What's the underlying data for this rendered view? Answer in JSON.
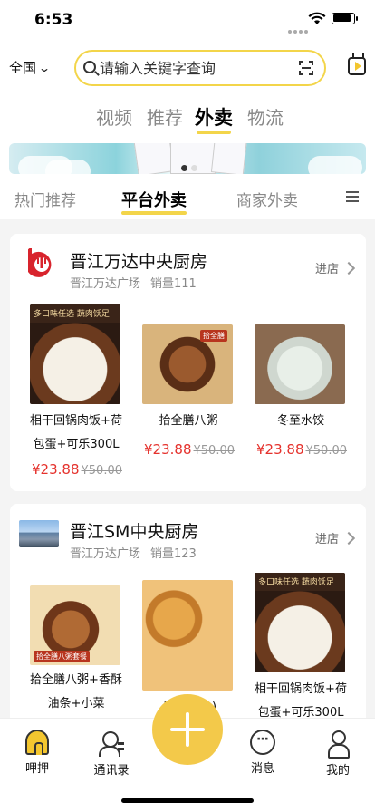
{
  "status_bar": {
    "time": "6:53"
  },
  "header": {
    "region": "全国",
    "search_placeholder": "请输入关键字查询"
  },
  "category_tabs": [
    {
      "label": "视频",
      "active": false
    },
    {
      "label": "推荐",
      "active": false
    },
    {
      "label": "外卖",
      "active": true
    },
    {
      "label": "物流",
      "active": false
    }
  ],
  "sub_tabs": [
    {
      "label": "热门推荐",
      "active": false
    },
    {
      "label": "平台外卖",
      "active": true
    },
    {
      "label": "商家外卖",
      "active": false
    }
  ],
  "shops": [
    {
      "name": "晋江万达中央厨房",
      "address": "晋江万达广场",
      "sales": "销量111",
      "enter_label": "进店",
      "products": [
        {
          "name_line1": "相干回锅肉饭+荷",
          "name_line2": "包蛋+可乐300L",
          "price": "¥23.88",
          "original_price": "¥50.00",
          "image": "rice-bowl",
          "image_caption": "多口味任选 蔬肉饫足"
        },
        {
          "name_line1": "拾全膳八粥",
          "name_line2": "",
          "price": "¥23.88",
          "original_price": "¥50.00",
          "image": "porridge",
          "image_caption": "拾全膳"
        },
        {
          "name_line1": "冬至水饺",
          "name_line2": "",
          "price": "¥23.88",
          "original_price": "¥50.00",
          "image": "dumplings",
          "image_caption": ""
        }
      ]
    },
    {
      "name": "晋江SM中央厨房",
      "address": "晋江万达广场",
      "sales": "销量123",
      "enter_label": "进店",
      "products": [
        {
          "name_line1": "拾全膳八粥+香酥",
          "name_line2": "油条+小菜",
          "image": "porridge-set",
          "image_caption": "拾全膳八粥套餐"
        },
        {
          "name_line1": "卜卜…(个)",
          "name_line2": "",
          "image": "fried-cakes",
          "image_caption": ""
        },
        {
          "name_line1": "相干回锅肉饭+荷",
          "name_line2": "包蛋+可乐300L",
          "image": "rice-bowl",
          "image_caption": "多口味任选 蔬肉饫足"
        }
      ]
    }
  ],
  "tab_bar": [
    {
      "label": "呷押",
      "icon": "home-icon",
      "active": true
    },
    {
      "label": "通讯录",
      "icon": "contacts-icon",
      "active": false
    },
    {
      "label": "消息",
      "icon": "message-icon",
      "active": false
    },
    {
      "label": "我的",
      "icon": "profile-icon",
      "active": false
    }
  ],
  "colors": {
    "accent": "#f3d54a",
    "price": "#e5322d",
    "fab": "#f3c94a"
  }
}
